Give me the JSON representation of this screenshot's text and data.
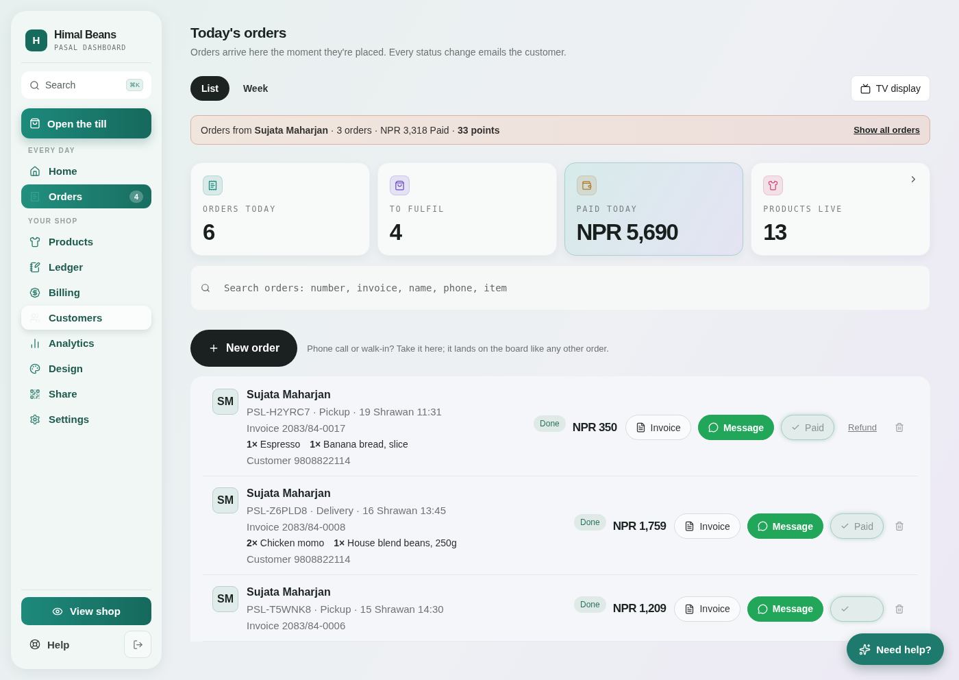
{
  "brand": {
    "initial": "H",
    "name": "Himal Beans",
    "subtitle": "PASAL DASHBOARD"
  },
  "sidebar_search": {
    "placeholder": "Search",
    "shortcut": "⌘K"
  },
  "primary_action": "Open the till",
  "nav_sections": [
    {
      "heading": "EVERY DAY",
      "items": [
        {
          "label": "Home",
          "selected": false,
          "highlighted": false
        },
        {
          "label": "Orders",
          "selected": true,
          "highlighted": false,
          "badge": "4"
        }
      ]
    },
    {
      "heading": "YOUR SHOP",
      "items": [
        {
          "label": "Products",
          "selected": false,
          "highlighted": false
        },
        {
          "label": "Ledger",
          "selected": false,
          "highlighted": false
        },
        {
          "label": "Billing",
          "selected": false,
          "highlighted": false
        },
        {
          "label": "Customers",
          "selected": false,
          "highlighted": true
        },
        {
          "label": "Analytics",
          "selected": false,
          "highlighted": false
        },
        {
          "label": "Design",
          "selected": false,
          "highlighted": false
        },
        {
          "label": "Share",
          "selected": false,
          "highlighted": false
        },
        {
          "label": "Settings",
          "selected": false,
          "highlighted": false
        }
      ]
    }
  ],
  "view_shop": "View shop",
  "help": "Help",
  "title": "Today's orders",
  "subtitle": "Orders arrive here the moment they're placed. Every status change emails the customer.",
  "view_tabs": [
    {
      "label": "List",
      "selected": true
    },
    {
      "label": "Week",
      "selected": false
    }
  ],
  "tv_button": "TV display",
  "filter_banner": {
    "text": "Orders from **Sujata Maharjan** · 3 orders · NPR 3,318 Paid · **33 points**",
    "link": "Show all orders"
  },
  "stats": [
    {
      "label": "ORDERS TODAY",
      "value": "6",
      "color": "#1a8a7a",
      "highlighted": false
    },
    {
      "label": "TO FULFIL",
      "value": "4",
      "color": "#6a4fc8",
      "highlighted": false
    },
    {
      "label": "PAID TODAY",
      "value": "NPR 5,690",
      "color": "#b07a2a",
      "highlighted": true
    },
    {
      "label": "PRODUCTS LIVE",
      "value": "13",
      "color": "#d0457a",
      "highlighted": false
    }
  ],
  "order_search": {
    "placeholder": "Search orders: number, invoice, name, phone, item"
  },
  "new_order": {
    "label": "New order",
    "hint": "Phone call or walk-in? Take it here; it lands on the board like any other order."
  },
  "orders": [
    {
      "initials": "SM",
      "name": "Sujata Maharjan",
      "reference": "PSL-H2YRC7 · Pickup · 19 Shrawan 11:31",
      "invoice": "Invoice 2083/84-0017",
      "items": [
        {
          "qty": "1×",
          "name": "Espresso"
        },
        {
          "qty": "1×",
          "name": "Banana bread, slice"
        }
      ],
      "customer": "Customer 9808822114",
      "status": "Done",
      "total": "NPR 350",
      "invoice_label": "Invoice",
      "message_label": "Message",
      "paid_label": "Paid",
      "refund_label": "Refund"
    },
    {
      "initials": "SM",
      "name": "Sujata Maharjan",
      "reference": "PSL-Z6PLD8 · Delivery · 16 Shrawan 13:45",
      "invoice": "Invoice 2083/84-0008",
      "items": [
        {
          "qty": "2×",
          "name": "Chicken momo"
        },
        {
          "qty": "1×",
          "name": "House blend beans, 250g"
        }
      ],
      "customer": "Customer 9808822114",
      "status": "Done",
      "total": "NPR 1,759",
      "invoice_label": "Invoice",
      "message_label": "Message",
      "paid_label": "Paid"
    },
    {
      "initials": "SM",
      "name": "Sujata Maharjan",
      "reference": "PSL-T5WNK8 · Pickup · 15 Shrawan 14:30",
      "invoice": "Invoice 2083/84-0006",
      "status": "Done",
      "total": "NPR 1,209",
      "invoice_label": "Invoice",
      "message_label": "Message"
    }
  ],
  "help_button": "Need help?"
}
